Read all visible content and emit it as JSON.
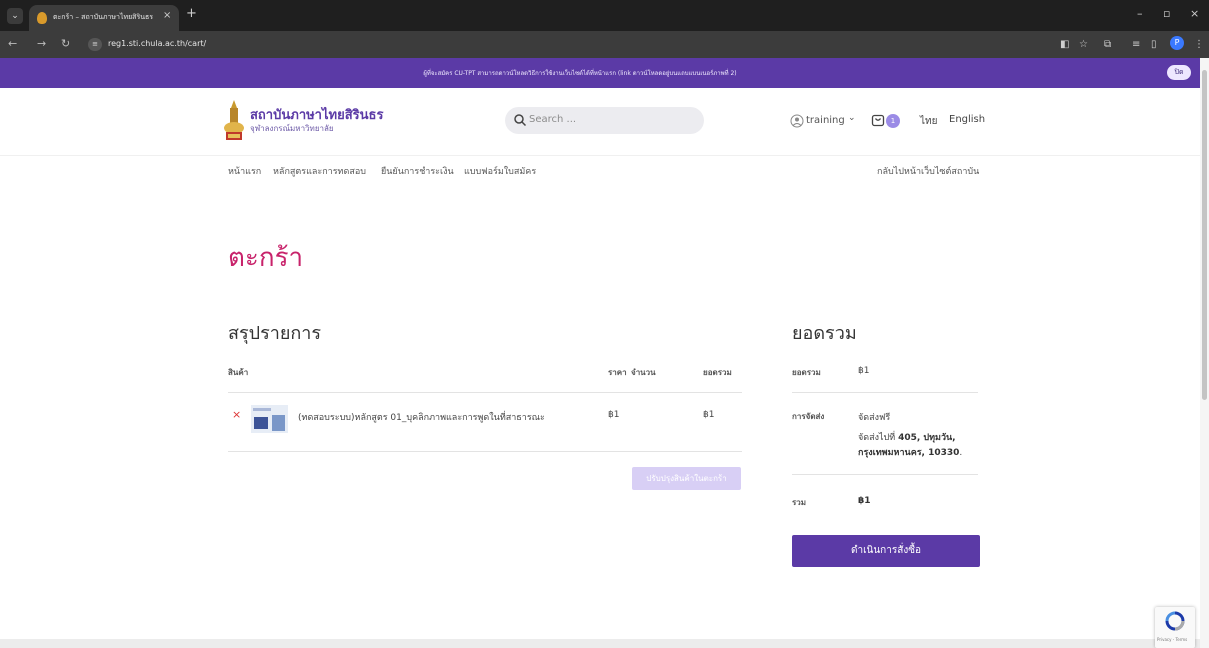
{
  "browser": {
    "tab_title": "ตะกร้า – สถาบันภาษาไทยสิรินธร จุฬา",
    "tab_close": "×",
    "new_tab": "+",
    "menu_icon": "chevron-down-icon",
    "window_minimize": "–",
    "window_restore": "▫",
    "window_close": "×",
    "url": "reg1.sti.chula.ac.th/cart/",
    "profile_initial": "P"
  },
  "announcement": {
    "text": "ผู้ที่จะสมัคร CU-TPT สามารถดาวน์โหลดวิธีการใช้งานเว็บไซต์ได้ที่หน้าแรก (link ดาวน์โหลดอยู่บนแถบแบนเนอร์ภาพที่ 2)",
    "close_label": "ปิด"
  },
  "header": {
    "site_name": "สถาบันภาษาไทยสิรินธร",
    "site_sub": "จุฬาลงกรณ์มหาวิทยาลัย",
    "search_placeholder": "Search ...",
    "user": "training",
    "user_chevron": "⌄",
    "cart_count": "1",
    "lang_th": "ไทย",
    "lang_en": "English"
  },
  "nav": {
    "items": [
      "หน้าแรก",
      "หลักสูตรและการทดสอบ",
      "ยืนยันการชำระเงิน",
      "แบบฟอร์มใบสมัคร"
    ],
    "back_link": "กลับไปหน้าเว็บไซต์สถาบัน"
  },
  "cart": {
    "page_title": "ตะกร้า",
    "summary_title": "สรุปรายการ",
    "col_product": "สินค้า",
    "col_price": "ราคา",
    "col_qty": "จำนวน",
    "col_total": "ยอดรวม",
    "items": [
      {
        "remove": "×",
        "name": "(ทดสอบระบบ)หลักสูตร 01_บุคลิกภาพและการพูดในที่สาธารณะ",
        "price": "฿1",
        "qty": "",
        "total": "฿1"
      }
    ],
    "update_button": "ปรับปรุงสินค้าในตะกร้า"
  },
  "totals": {
    "title": "ยอดรวม",
    "subtotal_label": "ยอดรวม",
    "subtotal_value": "฿1",
    "shipping_label": "การจัดส่ง",
    "shipping_method": "จัดส่งฟรี",
    "shipping_to_prefix": "จัดส่งไปที่",
    "shipping_to_address_1": "405, ปทุมวัน,",
    "shipping_to_address_2": "กรุงเทพมหานคร, 10330",
    "shipping_to_suffix": ".",
    "total_label": "รวม",
    "total_value": "฿1",
    "checkout_button": "ดำเนินการสั่งซื้อ"
  },
  "recaptcha": {
    "text": "Privacy - Terms"
  },
  "colors": {
    "brand_purple": "#5b3aa6",
    "title_pink": "#c8236b",
    "remove_red": "#dd3333"
  }
}
